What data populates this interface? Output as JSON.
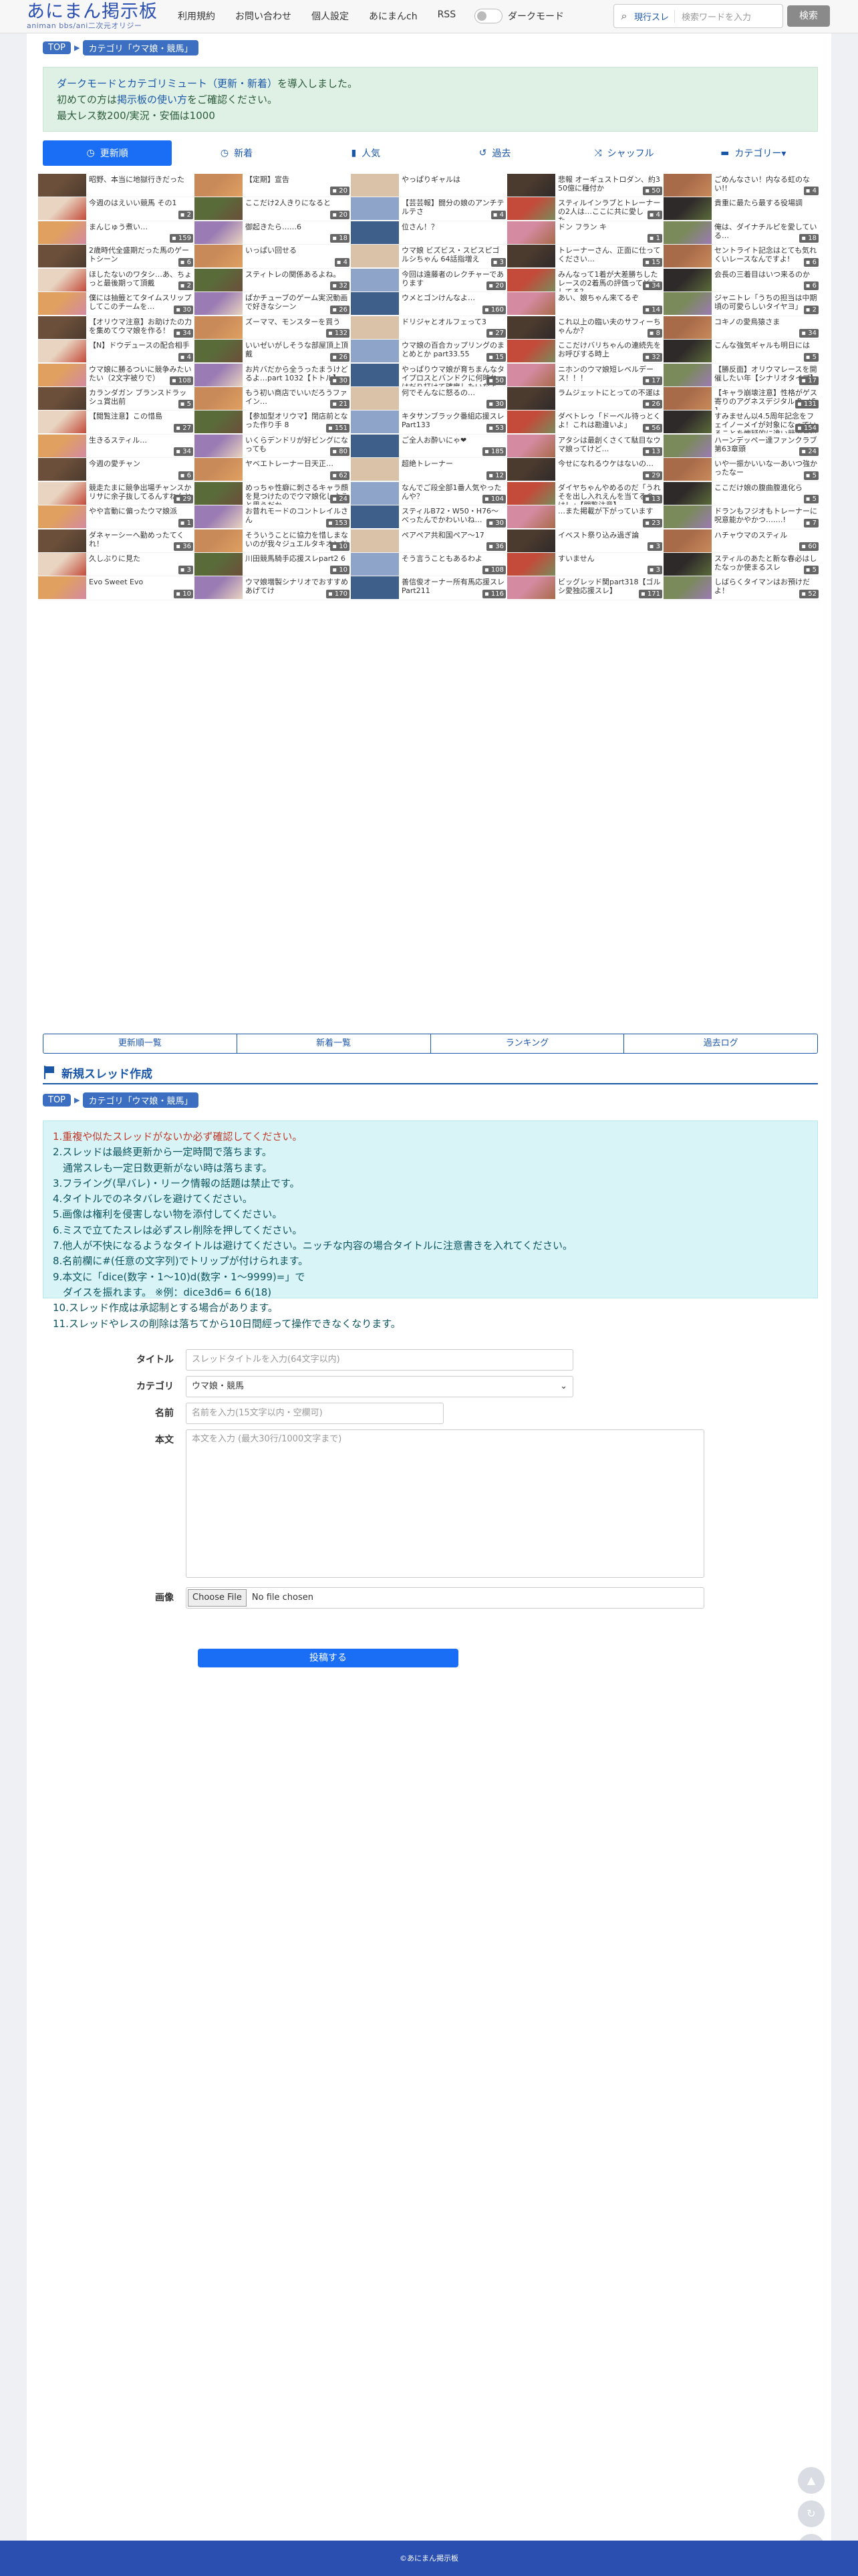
{
  "header": {
    "logo": "あにまん掲示板",
    "logo_sub": "animan bbs/ani二次元オリジー",
    "nav": [
      "利用規約",
      "お問い合わせ",
      "個人設定",
      "あにまんch",
      "RSS"
    ],
    "dark_label": "ダークモード",
    "search_scope": "現行スレ",
    "search_placeholder": "検索ワードを入力",
    "search_button": "検索"
  },
  "breadcrumb": {
    "top": "TOP",
    "category": "カテゴリ「ウマ娘・競馬」"
  },
  "notice": {
    "line1_link": "ダークモードとカテゴリミュート（更新・新着）",
    "line1_rest": "を導入しました。",
    "line2_pre": "初めての方は",
    "line2_link": "掲示板の使い方",
    "line2_post": "をご確認ください。",
    "line3": "最大レス数200/実況・安価は1000"
  },
  "tabs": [
    {
      "label": "更新順",
      "icon": "clock"
    },
    {
      "label": "新着",
      "icon": "clock"
    },
    {
      "label": "人気",
      "icon": "bar-chart"
    },
    {
      "label": "過去",
      "icon": "history"
    },
    {
      "label": "シャッフル",
      "icon": "shuffle"
    },
    {
      "label": "カテゴリー▾",
      "icon": "folder"
    }
  ],
  "threads": [
    {
      "t": "昭野、本当に地獄行きだった",
      "c": ""
    },
    {
      "t": "【定期】宣告",
      "c": "20"
    },
    {
      "t": "やっぱりギャルは",
      "c": ""
    },
    {
      "t": "悲報 オーギュストロダン、約350億に種付か",
      "c": "50"
    },
    {
      "t": "ごめんなさい！内なる虹のない!!",
      "c": "4"
    },
    {
      "t": "今週のはえいい競馬 その1",
      "c": "2"
    },
    {
      "t": "ここだけ2人きりになると",
      "c": "20"
    },
    {
      "t": "【芸芸報】闘分の娘のアンチテルテさ",
      "c": "4"
    },
    {
      "t": "スティルインラブとトレーナーの2人は…ここに共に愛した……",
      "c": "4"
    },
    {
      "t": "貴重に最たら最する役場調",
      "c": ""
    },
    {
      "t": "まんじゅう煮い…",
      "c": "159"
    },
    {
      "t": "御起きたら……6",
      "c": "18"
    },
    {
      "t": "位さん！？",
      "c": ""
    },
    {
      "t": "ドン フラン キ",
      "c": "1"
    },
    {
      "t": "俺は、ダイナチルピを愛している…",
      "c": "18"
    },
    {
      "t": "2歳時代全盛期だった馬のゲートシーン",
      "c": "6"
    },
    {
      "t": "いっぱい回せる",
      "c": "4"
    },
    {
      "t": "ウマ娘 ビズビス・スピスピゴルシちゃん 64話指増え",
      "c": "3"
    },
    {
      "t": "トレーナーさん、正面に仕ってください…",
      "c": "15"
    },
    {
      "t": "セントライト記念はとても気れくいレースなんですよ!",
      "c": "6"
    },
    {
      "t": "ほしたないのワタシ…あ、ちょっと最後期って頂戴",
      "c": "2"
    },
    {
      "t": "スティトレの関係あるよね。",
      "c": "32"
    },
    {
      "t": "今回は遠藤者のレクチャーであります",
      "c": "20"
    },
    {
      "t": "みんなって1着が大差勝ちしたレースの2着馬の評価ってどうしてる？",
      "c": "34"
    },
    {
      "t": "会長の三着目はいつ来るのか",
      "c": "6"
    },
    {
      "t": "僕には抽籤とてタイムスリップしてこのチームを…",
      "c": "30"
    },
    {
      "t": "ぱかチューブのゲーム実況動画で好きなシーン",
      "c": "26"
    },
    {
      "t": "ウメとゴンけんなよ…",
      "c": "160"
    },
    {
      "t": "あい、娘ちゃん来てるぞ",
      "c": "14"
    },
    {
      "t": "ジャニトレ「うちの担当は中期頃の可愛らしいタイヤヨ」",
      "c": "2"
    },
    {
      "t": "【オリウマ注意】お助けたの力を集めてウマ娘を作る！",
      "c": "34"
    },
    {
      "t": "ズーママ、モンスターを買う",
      "c": "132"
    },
    {
      "t": "ドリジャとオルフェって3",
      "c": "27"
    },
    {
      "t": "これ以上の臨い夫のサフィーちゃんか？",
      "c": "8"
    },
    {
      "t": "コキノの愛鳥猿さま",
      "c": "34"
    },
    {
      "t": "【N】ドウデュースの配合相手",
      "c": "4"
    },
    {
      "t": "いいゼいがしそうな部屋頂上頂戴",
      "c": "26"
    },
    {
      "t": "ウマ娘の百合カップリングのまとめとか part33.55",
      "c": "15"
    },
    {
      "t": "ここだけバリちゃんの連続先をお呼びする時上",
      "c": "32"
    },
    {
      "t": "こんな強気ギャルも明日には",
      "c": "5"
    },
    {
      "t": "ウマ娘に勝るついに競争みたいたい（2文字被りで）",
      "c": "108"
    },
    {
      "t": "お片バだから全うったまうけどるよ…part 1032【トトル】",
      "c": "30"
    },
    {
      "t": "やっぱりウマ娘が育ちまんなタイプロスとバンドクに何時れはだり打けて確度したいなよ…",
      "c": "50"
    },
    {
      "t": "ニホンのウマ娘短レベルデース！！！",
      "c": "17"
    },
    {
      "t": "【勝反面】オリウマレースを開催したい年【シナリオタイプ】",
      "c": "17"
    },
    {
      "t": "カランダガン ブランスドラッシュ賞出前",
      "c": "5"
    },
    {
      "t": "もう初い商店でいいだろうファイン…",
      "c": "21"
    },
    {
      "t": "何でそんなに怒るの…",
      "c": "30"
    },
    {
      "t": "ラムジェットにとっての不運は",
      "c": "26"
    },
    {
      "t": "【キャラ崩壊注意】性格がゲス寄りのアグネスデジタル Part51",
      "c": "131"
    },
    {
      "t": "【閲覧注意】この惜島",
      "c": "27"
    },
    {
      "t": "【参加型オリウマ】閉店前となった作り手 8",
      "c": "151"
    },
    {
      "t": "キタサンブラック番組応援スレPart133",
      "c": "53"
    },
    {
      "t": "ダベトレゥ「ドーベル待っとくよ！これは勘違いよ」",
      "c": "56"
    },
    {
      "t": "すみません以4.5周年記念をフェイノーメイが対象になっていることを懐疑的に違い競争を付けるものだった",
      "c": "154"
    },
    {
      "t": "生きるスティル…",
      "c": "34"
    },
    {
      "t": "いくらデンドリが好ビングになっても",
      "c": "80"
    },
    {
      "t": "ご全人お酔いにゃ❤",
      "c": "185"
    },
    {
      "t": "アタシは最創くさくて駄目なウマ娘ってけど…",
      "c": "13"
    },
    {
      "t": "ハーンデッペー達ファンクラブ 第63章頭",
      "c": "24"
    },
    {
      "t": "今週の愛チャン",
      "c": "6"
    },
    {
      "t": "ヤベエトレーナー日天正…",
      "c": "62"
    },
    {
      "t": "超絶トレーナー",
      "c": "12"
    },
    {
      "t": "今せになれるウケはないの…",
      "c": "29"
    },
    {
      "t": "いや一振かいいな一あいつ強かったなー",
      "c": "5"
    },
    {
      "t": "競走たまに競争出場チャンスかリサに余子抜してるんすねんと",
      "c": "29"
    },
    {
      "t": "めっちゃ性癖に刺さるキャラ顔を見つけたのでウマ娘化しようと思うだか",
      "c": "24"
    },
    {
      "t": "なんでご段全部1番人気やったんや？",
      "c": "104"
    },
    {
      "t": "ダイヤちゃんやめるのだ「うれそを出し入れえんを当てるのは！」【閲覧注意】",
      "c": "13"
    },
    {
      "t": "ここだけ娘の腹曲腹進化ら",
      "c": "5"
    },
    {
      "t": "やや言動に偏ったウマ娘派",
      "c": "1"
    },
    {
      "t": "お昔れモードのコントレイルさん",
      "c": "153"
    },
    {
      "t": "スティルB72・W50・H76〜べったんでかわいいね…",
      "c": "30"
    },
    {
      "t": "…また掲載が下がっています",
      "c": "23"
    },
    {
      "t": "ドランもフジオもトレーナーに呪意能かやかつ…….!",
      "c": "7"
    },
    {
      "t": "ダネャーシーへ勤めったてくれ！",
      "c": "36"
    },
    {
      "t": "そういうことに協力を惜しまないのが我々ジュエルタキオンだ",
      "c": "10"
    },
    {
      "t": "ペアペア共和国ペア〜17",
      "c": "36"
    },
    {
      "t": "イベスト祭り込み過ぎ論",
      "c": "3"
    },
    {
      "t": "ハチャウマのスティル",
      "c": "60"
    },
    {
      "t": "久しぶりに見た",
      "c": "3"
    },
    {
      "t": "川田競馬騎手応援スレpart2 6",
      "c": "10"
    },
    {
      "t": "そう言うこともあるわよ",
      "c": "108"
    },
    {
      "t": "すいません",
      "c": "3"
    },
    {
      "t": "スティルのあたと新な春必はしたなっか使まるスレ",
      "c": "5"
    },
    {
      "t": "Evo Sweet Evo",
      "c": "10"
    },
    {
      "t": "ウマ娘増製シナリオでおすすめあげてけ",
      "c": "170"
    },
    {
      "t": "善信俊オーナー所有馬応援スレPart211",
      "c": "116"
    },
    {
      "t": "ビッグレッド関part318【ゴルシ愛独応援スレ】",
      "c": "171"
    },
    {
      "t": "しばらくタイマンはお預けだよ！",
      "c": "52"
    }
  ],
  "thumb_colors": [
    "#6b4f3a",
    "#c98a5a",
    "#d9c2a8",
    "#4b3a2e",
    "#a86b4a",
    "#e8d4c0",
    "#5a6b3a",
    "#8fa4c9",
    "#c44a3a",
    "#2f2a2a",
    "#e0a060",
    "#9b7bb3",
    "#3e5f8a",
    "#d48aa0",
    "#7a8a5a"
  ],
  "bottom_links": [
    "更新順一覧",
    "新着一覧",
    "ランキング",
    "過去ログ"
  ],
  "new_thread": {
    "title": "新規スレッド作成"
  },
  "rules": [
    "1.重複や似たスレッドがないか必ず確認してください。",
    "2.スレッドは最終更新から一定時間で落ちます。",
    "　通常スレも一定日数更新がない時は落ちます。",
    "3.フライング(早バレ)・リーク情報の話題は禁止です。",
    "4.タイトルでのネタバレを避けてください。",
    "5.画像は権利を侵害しない物を添付してください。",
    "6.ミスで立てたスレは必ずスレ削除を押してください。",
    "7.他人が不快になるようなタイトルは避けてください。ニッチな内容の場合タイトルに注意書きを入れてください。",
    "8.名前欄に#(任意の文字列)でトリップが付けられます。",
    "9.本文に「dice(数字・1〜10)d(数字・1〜9999)=」で",
    "　ダイスを振れます。 ※例：dice3d6= 6 6(18)",
    "10.スレッド作成は承認制とする場合があります。",
    "11.スレッドやレスの削除は落ちてから10日間經って操作できなくなります。"
  ],
  "form": {
    "title_label": "タイトル",
    "title_placeholder": "スレッドタイトルを入力(64文字以内)",
    "category_label": "カテゴリ",
    "category_value": "ウマ娘・競馬",
    "name_label": "名前",
    "name_placeholder": "名前を入力(15文字以内・空欄可)",
    "body_label": "本文",
    "body_placeholder": "本文を入力 (最大30行/1000文字まで)",
    "image_label": "画像",
    "file_button": "Choose File",
    "file_status": "No file chosen",
    "submit": "投稿する"
  },
  "footer": "©あにまん掲示板"
}
